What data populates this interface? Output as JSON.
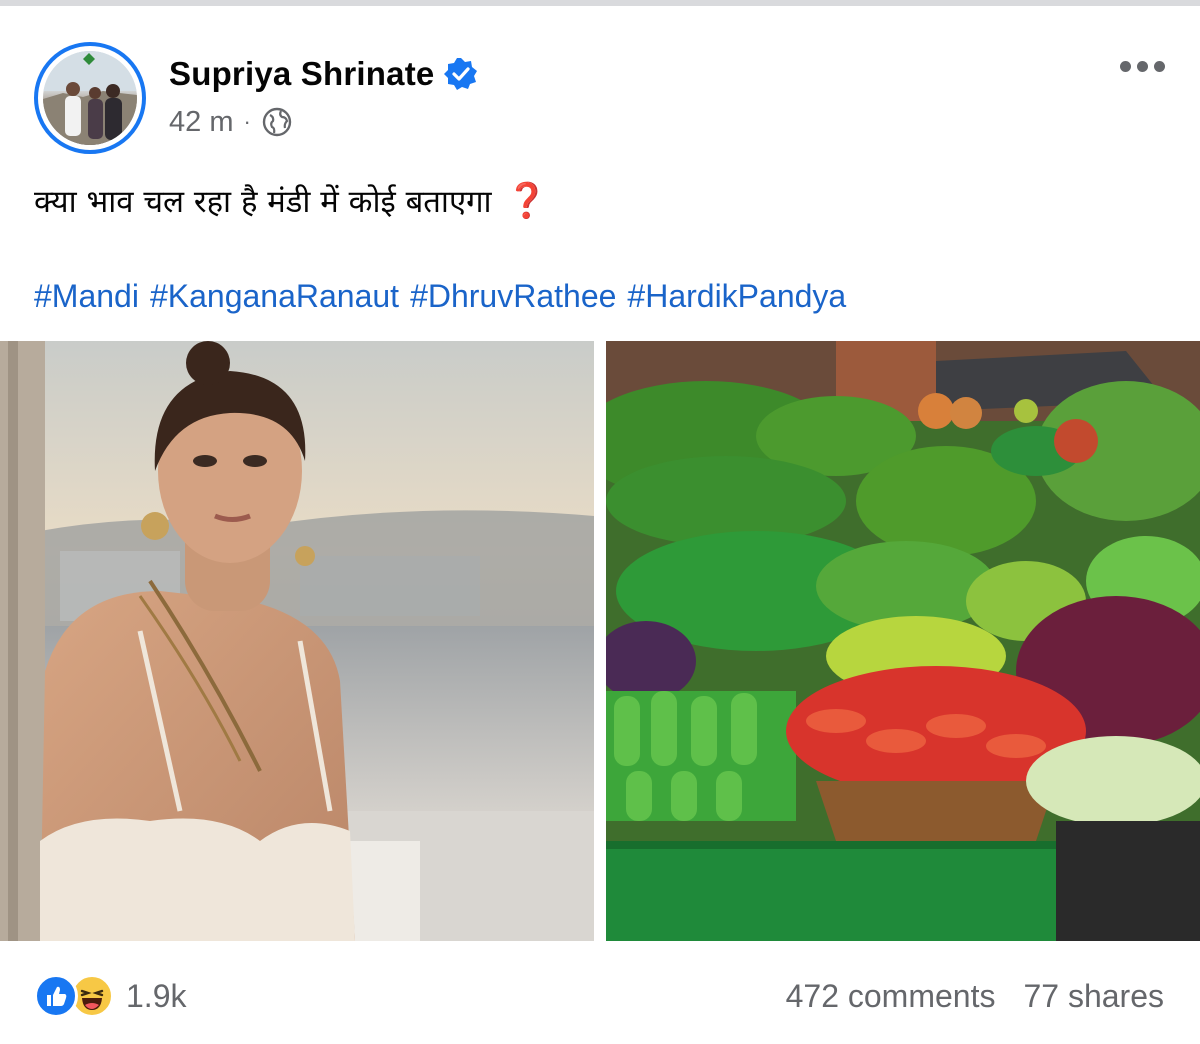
{
  "post": {
    "author": "Supriya Shrinate",
    "verified": true,
    "timestamp": "42 m",
    "separator": "·",
    "audience_icon": "globe-icon",
    "more_icon": "more-horizontal-icon",
    "text": "क्या भाव चल रहा है मंडी में कोई बताएगा",
    "text_emoji": "❓",
    "hashtags": [
      "#Mandi",
      "#KanganaRanaut",
      "#DhruvRathee",
      "#HardikPandya"
    ],
    "images": [
      {
        "subject": "woman-portrait-photo"
      },
      {
        "subject": "vegetable-market-photo"
      }
    ]
  },
  "footer": {
    "reactions": [
      "like-icon",
      "haha-icon"
    ],
    "reaction_count": "1.9k",
    "comments": "472 comments",
    "shares": "77 shares"
  },
  "colors": {
    "brand_blue": "#1877f2",
    "hashtag_blue": "#1a64c9",
    "meta_gray": "#65676b",
    "emoji_red": "#e0242c"
  }
}
